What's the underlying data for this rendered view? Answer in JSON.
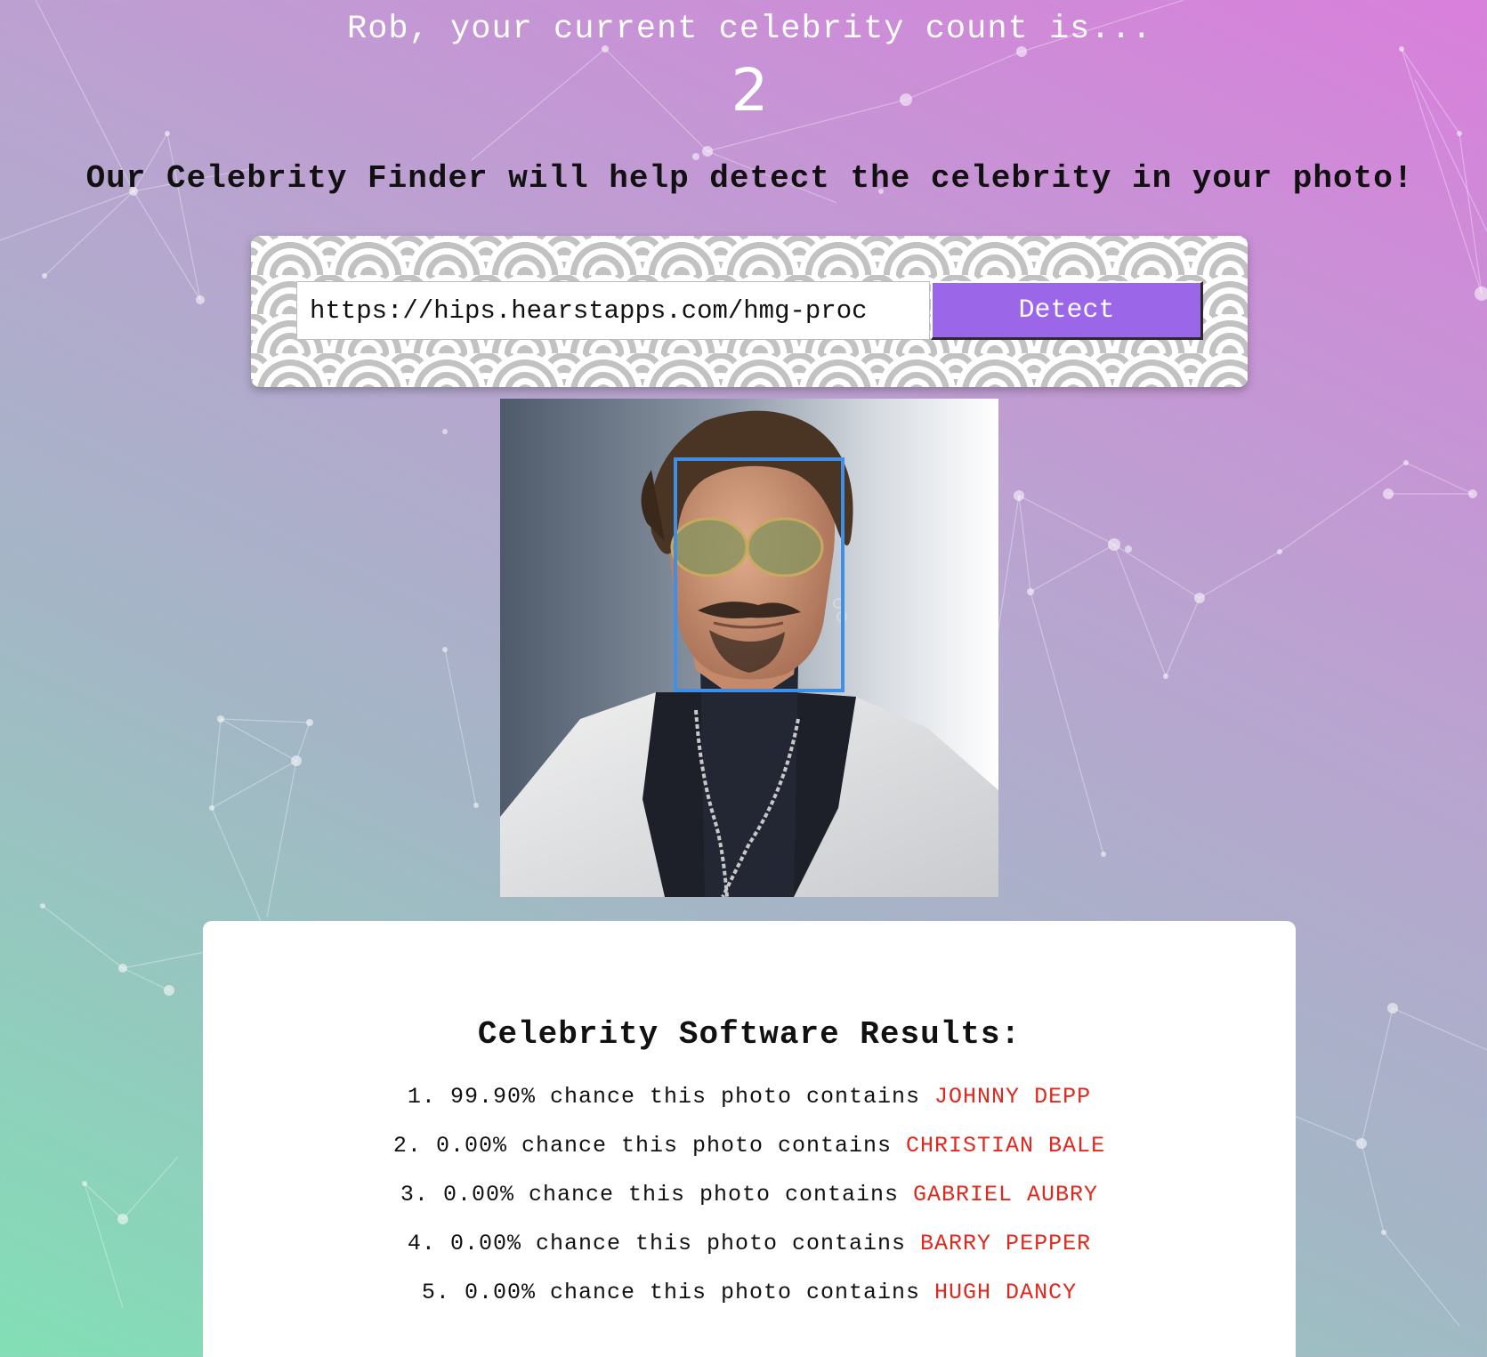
{
  "header": {
    "greeting": "Rob, your current celebrity count is...",
    "count": "2",
    "tagline": "Our Celebrity Finder will help detect the celebrity in your photo!"
  },
  "form": {
    "url_value": "https://hips.hearstapps.com/hmg-proc",
    "detect_label": "Detect"
  },
  "results": {
    "title": "Celebrity Software Results:",
    "items": [
      {
        "num": "1.",
        "text": "99.90% chance this photo contains",
        "name": "JOHNNY DEPP"
      },
      {
        "num": "2.",
        "text": "0.00% chance this photo contains",
        "name": "CHRISTIAN BALE"
      },
      {
        "num": "3.",
        "text": "0.00% chance this photo contains",
        "name": "GABRIEL AUBRY"
      },
      {
        "num": "4.",
        "text": "0.00% chance this photo contains",
        "name": "BARRY PEPPER"
      },
      {
        "num": "5.",
        "text": "0.00% chance this photo contains",
        "name": "HUGH DANCY"
      }
    ]
  },
  "colors": {
    "accent_button": "#9b66e8",
    "face_box": "#3f8fe6",
    "celebrity_name": "#e0291e",
    "gradient_top_right": "#d97fdc",
    "gradient_bottom_left": "#82dfb6"
  }
}
